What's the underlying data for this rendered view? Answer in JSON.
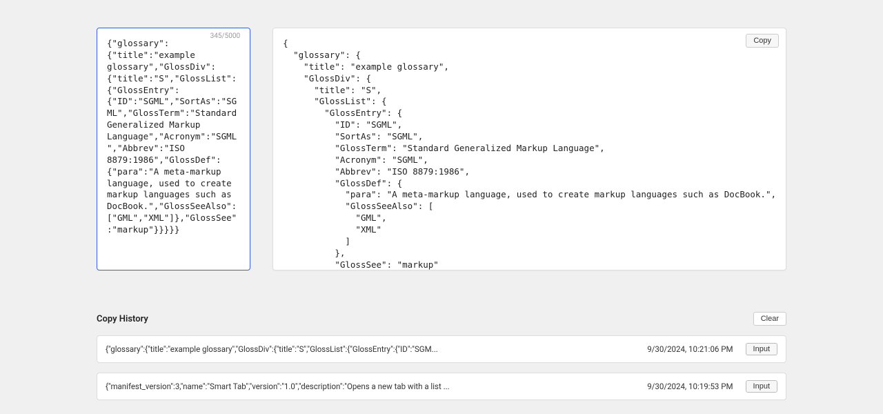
{
  "input": {
    "text": "{\"glossary\":{\"title\":\"example glossary\",\"GlossDiv\":{\"title\":\"S\",\"GlossList\":{\"GlossEntry\":{\"ID\":\"SGML\",\"SortAs\":\"SGML\",\"GlossTerm\":\"Standard Generalized Markup Language\",\"Acronym\":\"SGML\",\"Abbrev\":\"ISO 8879:1986\",\"GlossDef\":{\"para\":\"A meta-markup language, used to create markup languages such as DocBook.\",\"GlossSeeAlso\":[\"GML\",\"XML\"]},\"GlossSee\":\"markup\"}}}}}",
    "counter": "345/5000"
  },
  "output": {
    "copy_label": "Copy",
    "text": "{\n  \"glossary\": {\n    \"title\": \"example glossary\",\n    \"GlossDiv\": {\n      \"title\": \"S\",\n      \"GlossList\": {\n        \"GlossEntry\": {\n          \"ID\": \"SGML\",\n          \"SortAs\": \"SGML\",\n          \"GlossTerm\": \"Standard Generalized Markup Language\",\n          \"Acronym\": \"SGML\",\n          \"Abbrev\": \"ISO 8879:1986\",\n          \"GlossDef\": {\n            \"para\": \"A meta-markup language, used to create markup languages such as DocBook.\",\n            \"GlossSeeAlso\": [\n              \"GML\",\n              \"XML\"\n            ]\n          },\n          \"GlossSee\": \"markup\""
  },
  "history": {
    "title": "Copy History",
    "clear_label": "Clear",
    "items": [
      {
        "text": "{\"glossary\":{\"title\":\"example glossary\",\"GlossDiv\":{\"title\":\"S\",\"GlossList\":{\"GlossEntry\":{\"ID\":\"SGM...",
        "time": "9/30/2024, 10:21:06 PM",
        "btn": "Input"
      },
      {
        "text": "{\"manifest_version\":3,\"name\":\"Smart Tab\",\"version\":\"1.0\",\"description\":\"Opens a new tab with a list ...",
        "time": "9/30/2024, 10:19:53 PM",
        "btn": "Input"
      }
    ]
  }
}
